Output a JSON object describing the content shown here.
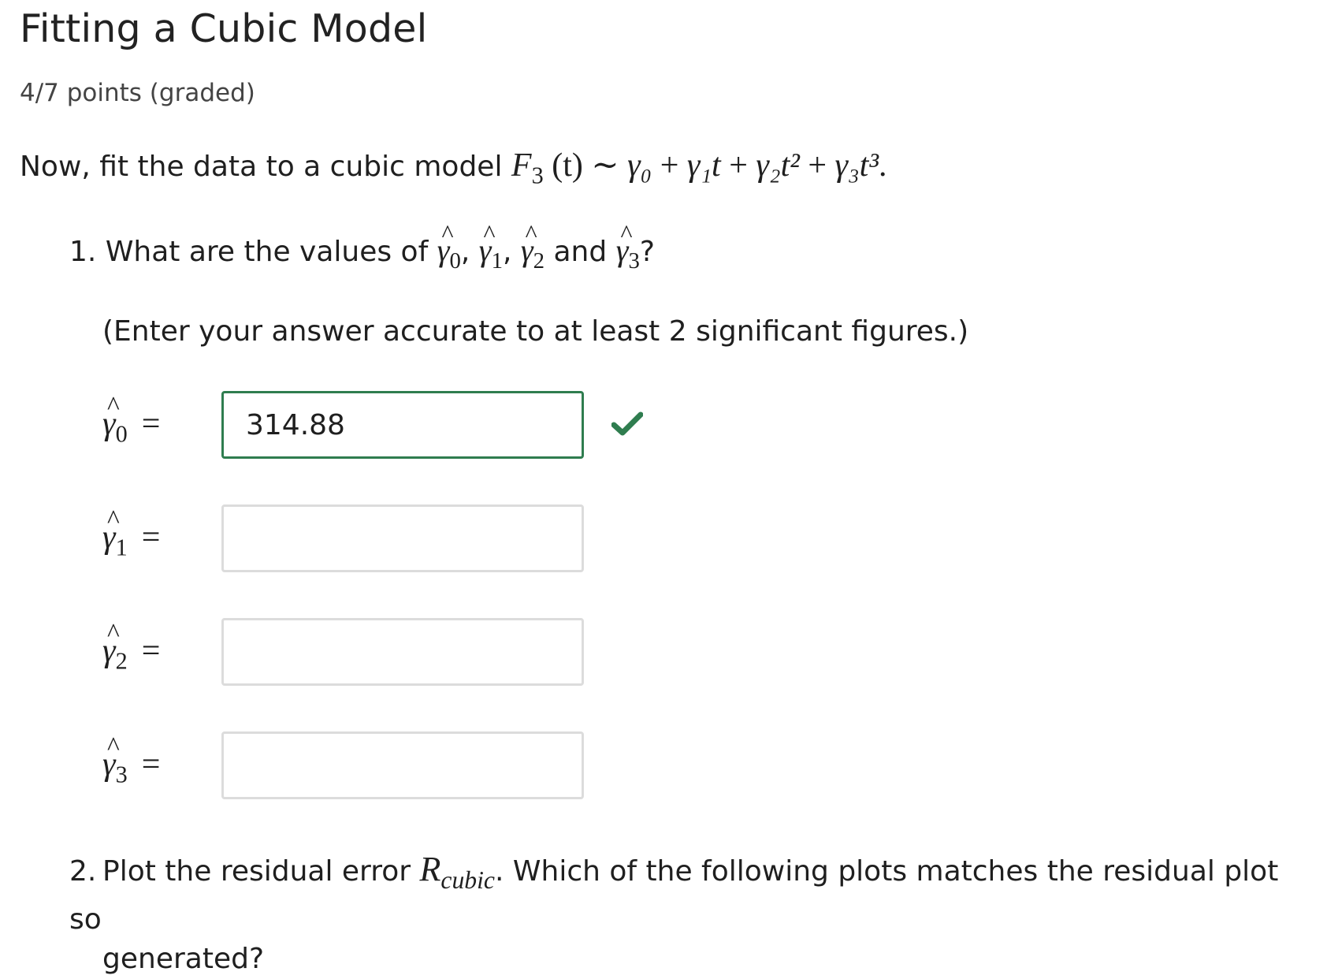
{
  "problem": {
    "title": "Fitting a Cubic Model",
    "points": "4/7 points (graded)",
    "intro_text": "Now, fit the data to a cubic model",
    "model_lhs": "F",
    "model_lhs_sub": "3",
    "model_arg": "(t)",
    "model_tilde": "∼",
    "model_rhs_terms": [
      "γ₀",
      "γ₁t",
      "γ₂t²",
      "γ₃t³"
    ],
    "model_end": "."
  },
  "question1": {
    "number": "1.",
    "text_before": "What are the values of",
    "sep1": ",",
    "sep2": ",",
    "and_word": "and",
    "qmark": "?",
    "hint": "(Enter your answer accurate to at least 2 significant figures.)"
  },
  "answers": [
    {
      "symbol": "γ",
      "sub": "0",
      "value": "314.88",
      "status": "correct"
    },
    {
      "symbol": "γ",
      "sub": "1",
      "value": "",
      "status": "empty"
    },
    {
      "symbol": "γ",
      "sub": "2",
      "value": "",
      "status": "empty"
    },
    {
      "symbol": "γ",
      "sub": "3",
      "value": "",
      "status": "empty"
    }
  ],
  "question2": {
    "number": "2.",
    "text_before": "Plot the residual error",
    "symbol": "R",
    "symbol_sub": "cubic",
    "period": ".",
    "text_after": "Which of the following plots matches the residual plot so",
    "text_line2": "generated?"
  },
  "colors": {
    "correct": "#2f7d4f",
    "input_border": "#dcdcdc",
    "text": "#1f1f1f"
  },
  "icons": {
    "check": "check-icon"
  }
}
